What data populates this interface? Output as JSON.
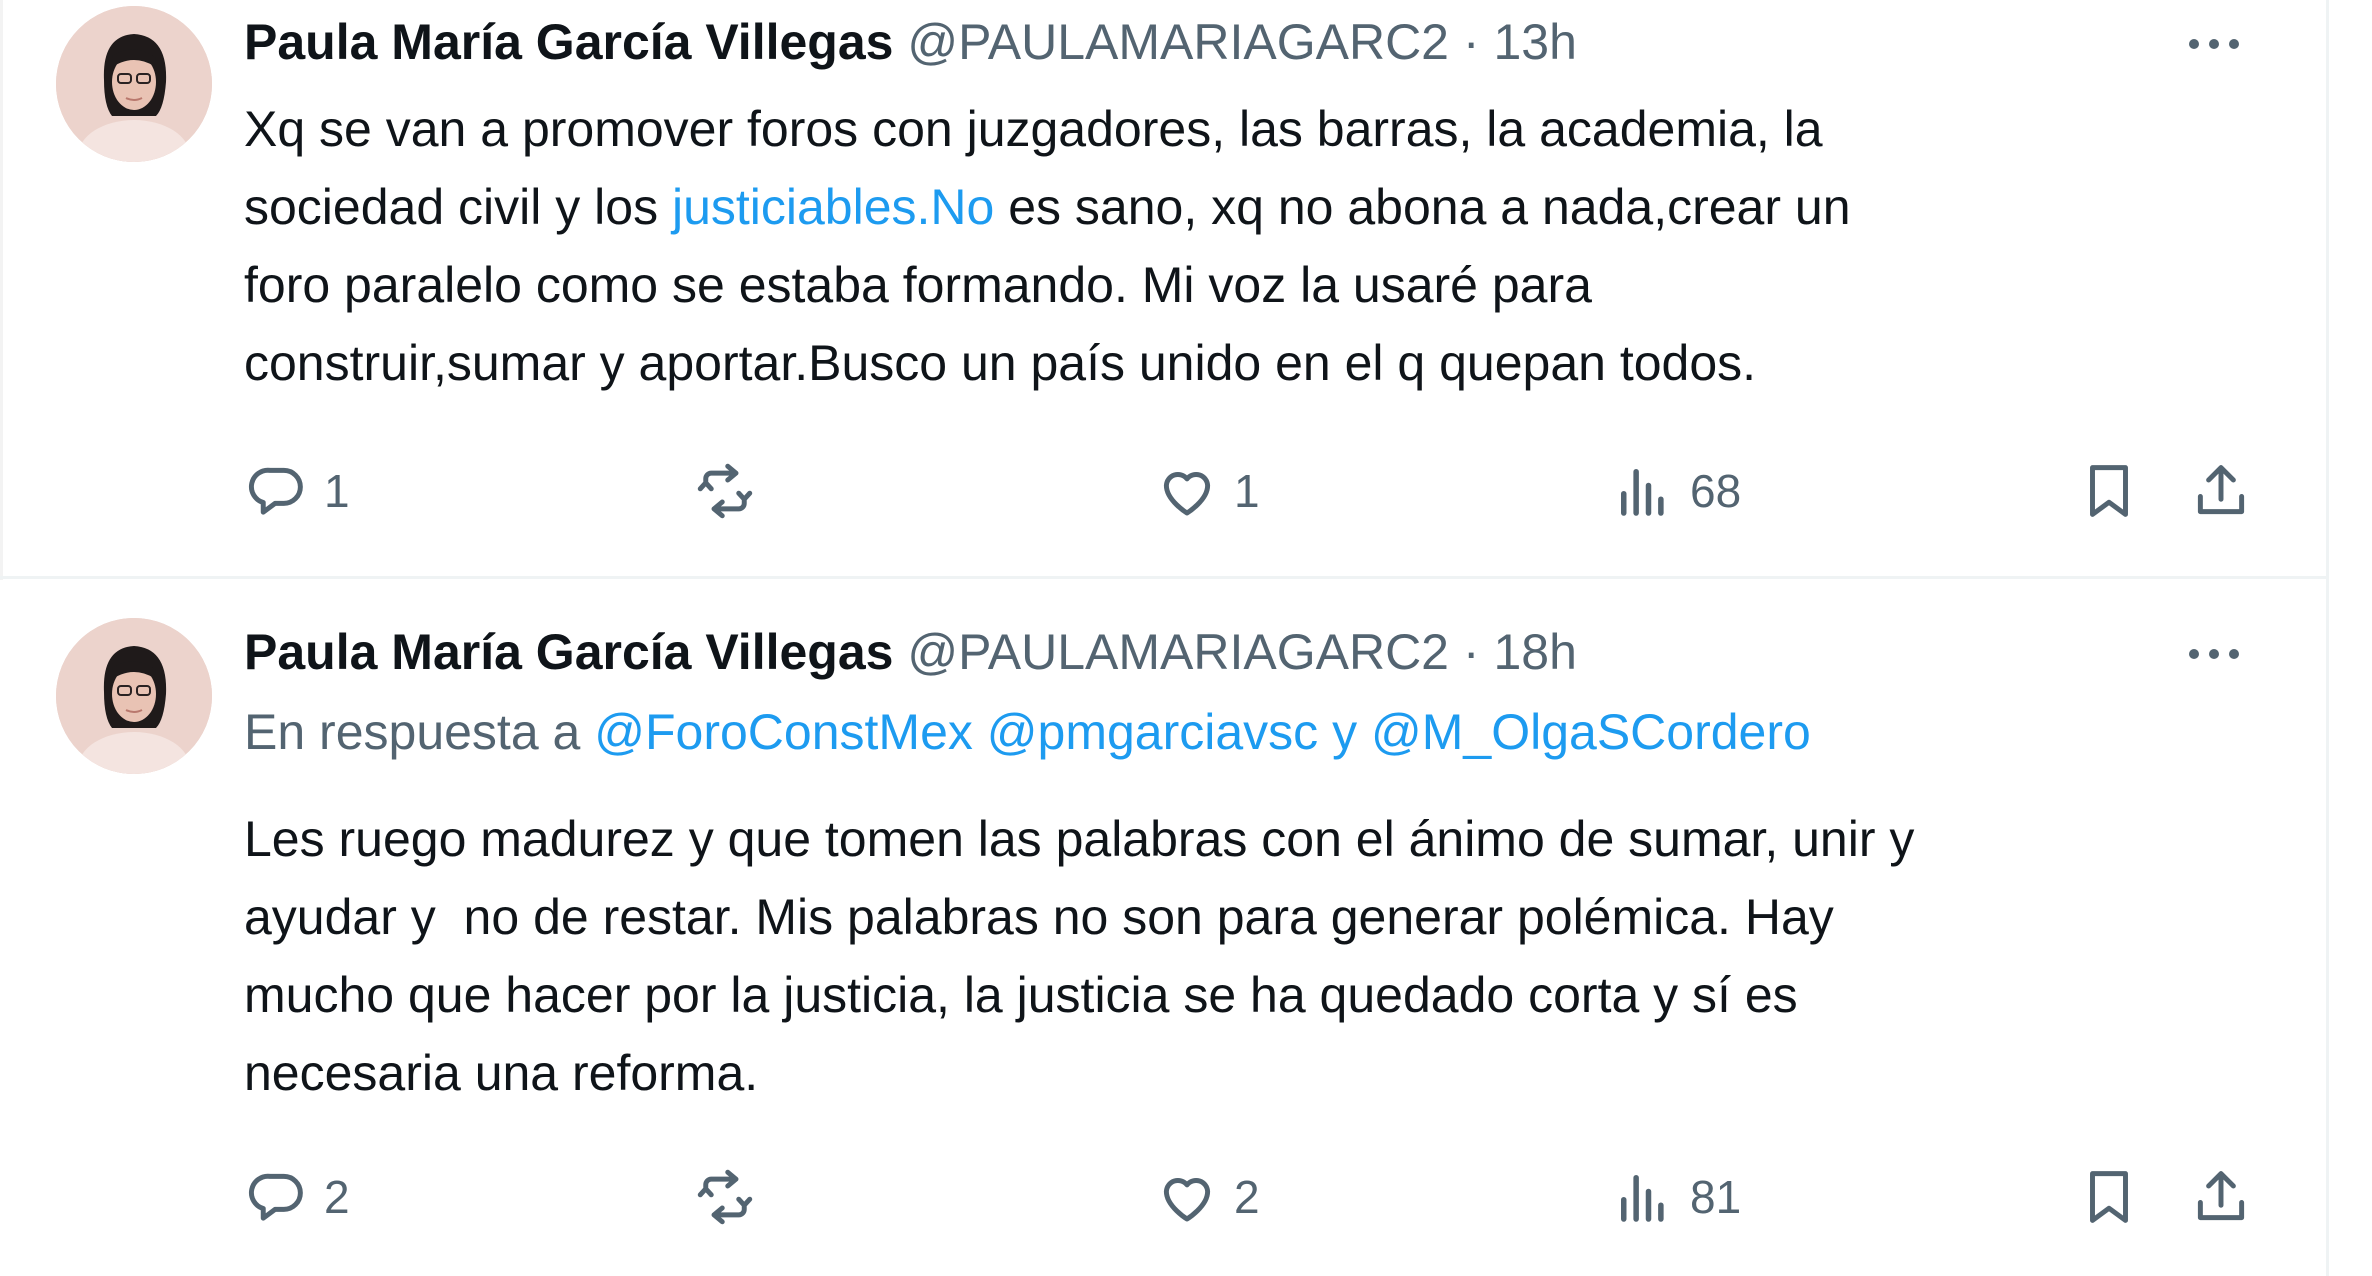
{
  "tweets": [
    {
      "author": {
        "name": "Paula María García Villegas",
        "handle": "@PAULAMARIAGARC2"
      },
      "separator": "·",
      "time": "13h",
      "body_lines": [
        "Xq se van a promover foros con juzgadores, las barras, la academia, la",
        "sociedad civil y los ",
        "justiciables.No",
        " es sano, xq no abona a nada,crear un",
        "foro paralelo como se estaba formando. Mi voz la usaré para",
        "construir,sumar y aportar.Busco un país unido en el q quepan todos."
      ],
      "stats": {
        "replies": "1",
        "retweets": "",
        "likes": "1",
        "views": "68"
      }
    },
    {
      "author": {
        "name": "Paula María García Villegas",
        "handle": "@PAULAMARIAGARC2"
      },
      "separator": "·",
      "time": "18h",
      "reply_prefix": "En respuesta a ",
      "mentions": [
        "@ForoConstMex",
        "@pmgarciavsc",
        "@M_OlgaSCordero"
      ],
      "conjunction": " y ",
      "body_lines": [
        "Les ruego madurez y que tomen las palabras con el ánimo de sumar, unir y",
        "ayudar y  no de restar. Mis palabras no son para generar polémica. Hay",
        "mucho que hacer por la justicia, la justicia se ha quedado corta y sí es",
        "necesaria una reforma."
      ],
      "stats": {
        "replies": "2",
        "retweets": "",
        "likes": "2",
        "views": "81"
      }
    }
  ],
  "icons": {
    "reply": "reply-icon",
    "retweet": "retweet-icon",
    "like": "heart-icon",
    "views": "views-icon",
    "bookmark": "bookmark-icon",
    "share": "share-icon",
    "more": "more-icon"
  },
  "colors": {
    "link": "#1d9bf0",
    "secondary_text": "#536471",
    "primary_text": "#0f1419"
  }
}
